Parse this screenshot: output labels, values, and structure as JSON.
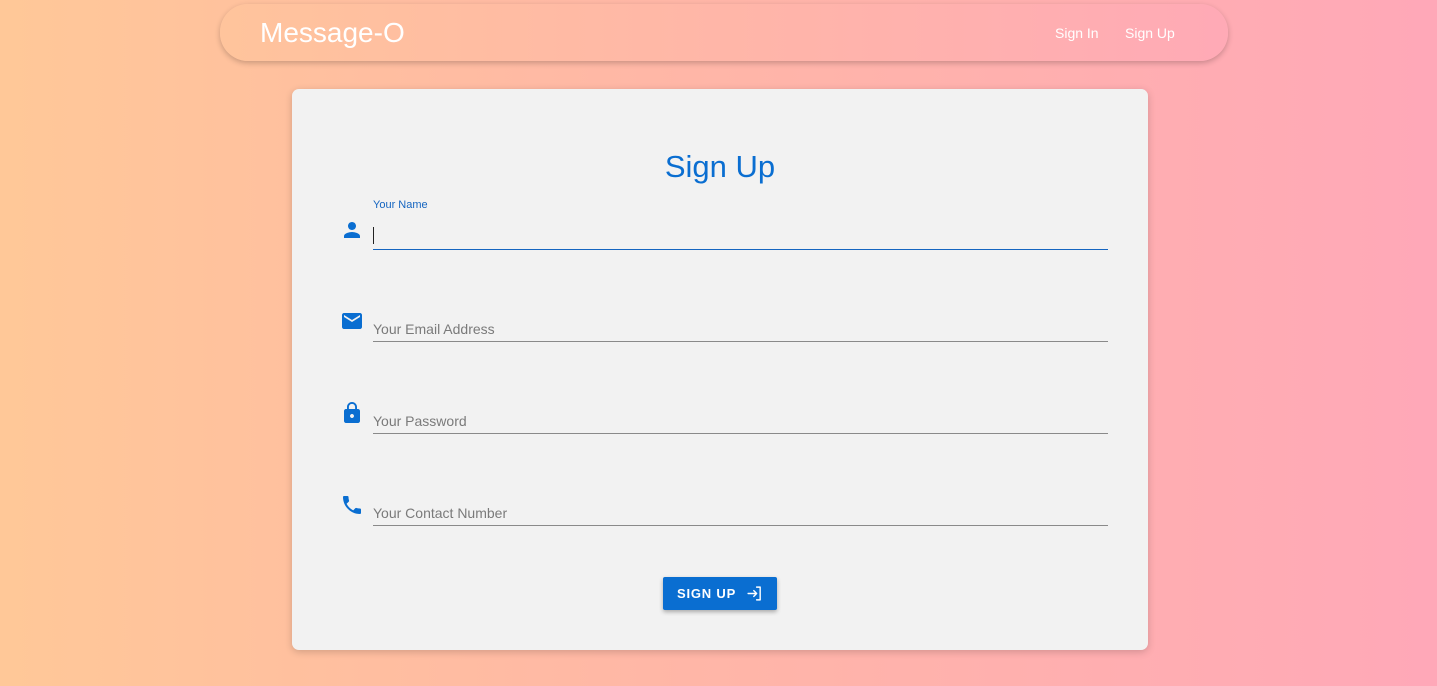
{
  "app": {
    "brand": "Message-O"
  },
  "nav": {
    "sign_in": "Sign In",
    "sign_up": "Sign Up"
  },
  "form": {
    "title": "Sign Up",
    "fields": [
      {
        "label": "Your Name",
        "value": "",
        "focused": true,
        "icon": "person-icon"
      },
      {
        "placeholder": "Your Email Address",
        "value": "",
        "icon": "email-icon"
      },
      {
        "placeholder": "Your Password",
        "value": "",
        "icon": "lock-icon"
      },
      {
        "placeholder": "Your Contact Number",
        "value": "",
        "icon": "phone-icon"
      }
    ],
    "submit_label": "SIGN UP",
    "submit_icon": "login-icon"
  },
  "colors": {
    "accent": "#0a6ed1",
    "card": "#f2f2f2",
    "gradient_start": "#ffc898",
    "gradient_end": "#ffa8b8"
  }
}
